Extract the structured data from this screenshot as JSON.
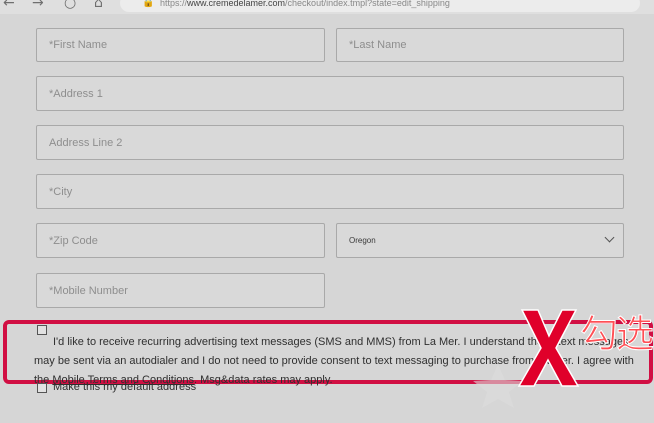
{
  "browser": {
    "back_icon": "←",
    "forward_icon": "→",
    "reload_icon": "○",
    "home_icon": "⌂",
    "lock_icon": "🔒",
    "url_prefix": "https://",
    "url_domain": "www.cremedelamer.com",
    "url_path": "/checkout/index.tmpl?state=edit_shipping"
  },
  "form": {
    "first_name_placeholder": "*First Name",
    "last_name_placeholder": "*Last Name",
    "address1_placeholder": "*Address 1",
    "address2_placeholder": "Address Line 2",
    "city_placeholder": "*City",
    "zip_placeholder": "*Zip Code",
    "state_value": "Oregon",
    "mobile_placeholder": "*Mobile Number"
  },
  "consent": {
    "text_before_link": "I'd like to receive recurring advertising text messages (SMS and MMS) from La Mer. I understand these text messages may be sent via an autodialer and I do not need to provide consent to text messaging to purchase from La Mer. I agree with the ",
    "link_text": "Mobile Terms and Conditions",
    "text_after_link": ". Msg&data rates may apply.",
    "checked": false
  },
  "default_address": {
    "label": "Make this my default address",
    "checked": false
  },
  "annotation": {
    "overlay_text": "勾选",
    "colors": {
      "highlight": "#d10f43",
      "x_mark": "#e0002a",
      "overlay_text": "#ff4f55"
    }
  }
}
